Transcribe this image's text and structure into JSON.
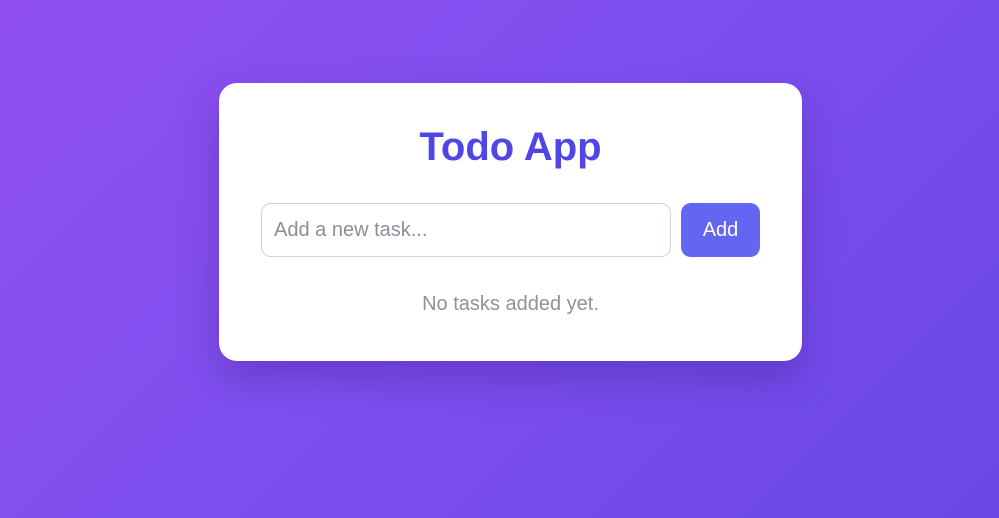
{
  "app": {
    "title": "Todo App"
  },
  "form": {
    "input_value": "",
    "input_placeholder": "Add a new task...",
    "add_label": "Add"
  },
  "tasks": {
    "items": [],
    "empty_message": "No tasks added yet."
  },
  "colors": {
    "accent": "#4f46e5",
    "button": "#6366f1",
    "background_start": "#904ff0",
    "background_end": "#6a48e6",
    "muted_text": "#8b93a0"
  }
}
